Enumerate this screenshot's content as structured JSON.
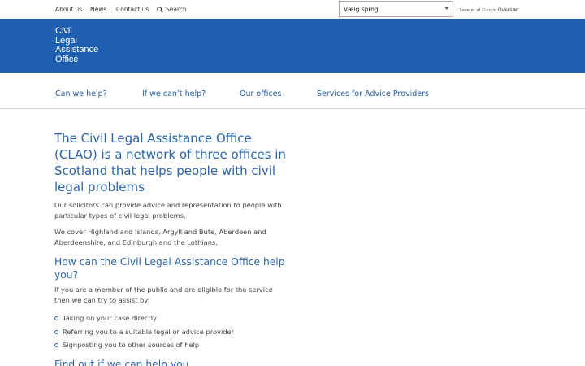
{
  "topbar": {
    "links": [
      "About us",
      "News",
      "Contact us"
    ],
    "search_label": "Search",
    "language_select": "Vælg sprog",
    "powered_prefix": "Leveret af",
    "powered_google": "Google",
    "powered_translate": "Oversæt"
  },
  "logo": {
    "lines": [
      "Civil",
      "Legal",
      "Assistance",
      "Office"
    ]
  },
  "nav": {
    "items": [
      "Can we help?",
      "If we can’t help?",
      "Our offices",
      "Services for Advice Providers"
    ]
  },
  "main": {
    "title": "The Civil Legal Assistance Office (CLAO) is a network of three offices in Scotland that helps people with civil legal problems",
    "intro1": "Our solicitors can provide advice and representation to people with particular types of civil legal problems.",
    "intro2": "We cover Highland and Islands, Argyll and Bute, Aberdeen and Aberdeenshire, and Edinburgh and the Lothians.",
    "heading2": "How can the Civil Legal Assistance Office help you?",
    "eligibility": "If you are a member of the public and are eligible for the service then we can try to assist by:",
    "assist_items": [
      "Taking on your case directly",
      "Referring you to a suitable legal or advice provider",
      "Signposting you to other sources of help"
    ],
    "heading3": "Find out if we can help you"
  },
  "colors": {
    "header_blue": "#1f5fb0",
    "heading_blue": "#2a63a8",
    "nav_blue": "#1f5a9e"
  }
}
